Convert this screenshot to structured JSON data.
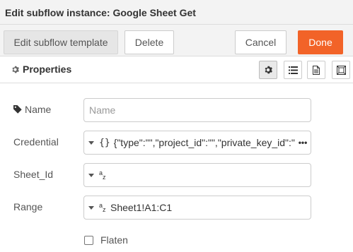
{
  "dialog": {
    "title": "Edit subflow instance: Google Sheet Get"
  },
  "toolbar": {
    "edit_template_label": "Edit subflow template",
    "delete_label": "Delete",
    "cancel_label": "Cancel",
    "done_label": "Done",
    "done_color": "#f26328"
  },
  "section": {
    "properties_label": "Properties",
    "properties_icon": "gear-icon",
    "tabs": [
      {
        "icon": "gear-icon",
        "active": true
      },
      {
        "icon": "list-icon",
        "active": false
      },
      {
        "icon": "document-icon",
        "active": false
      },
      {
        "icon": "frame-icon",
        "active": false
      }
    ]
  },
  "form": {
    "name": {
      "label": "Name",
      "icon": "tag-icon",
      "placeholder": "Name",
      "value": ""
    },
    "credential": {
      "label": "Credential",
      "type_icon": "{}",
      "value": "{\"type\":\"\",\"project_id\":\"\",\"private_key_id\":\""
    },
    "sheet_id": {
      "label": "Sheet_Id",
      "type_icon_a": "a",
      "type_icon_z": "z",
      "value": ""
    },
    "range": {
      "label": "Range",
      "type_icon_a": "a",
      "type_icon_z": "z",
      "value": "Sheet1!A1:C1"
    },
    "flaten": {
      "label": "Flaten",
      "checked": false
    }
  }
}
